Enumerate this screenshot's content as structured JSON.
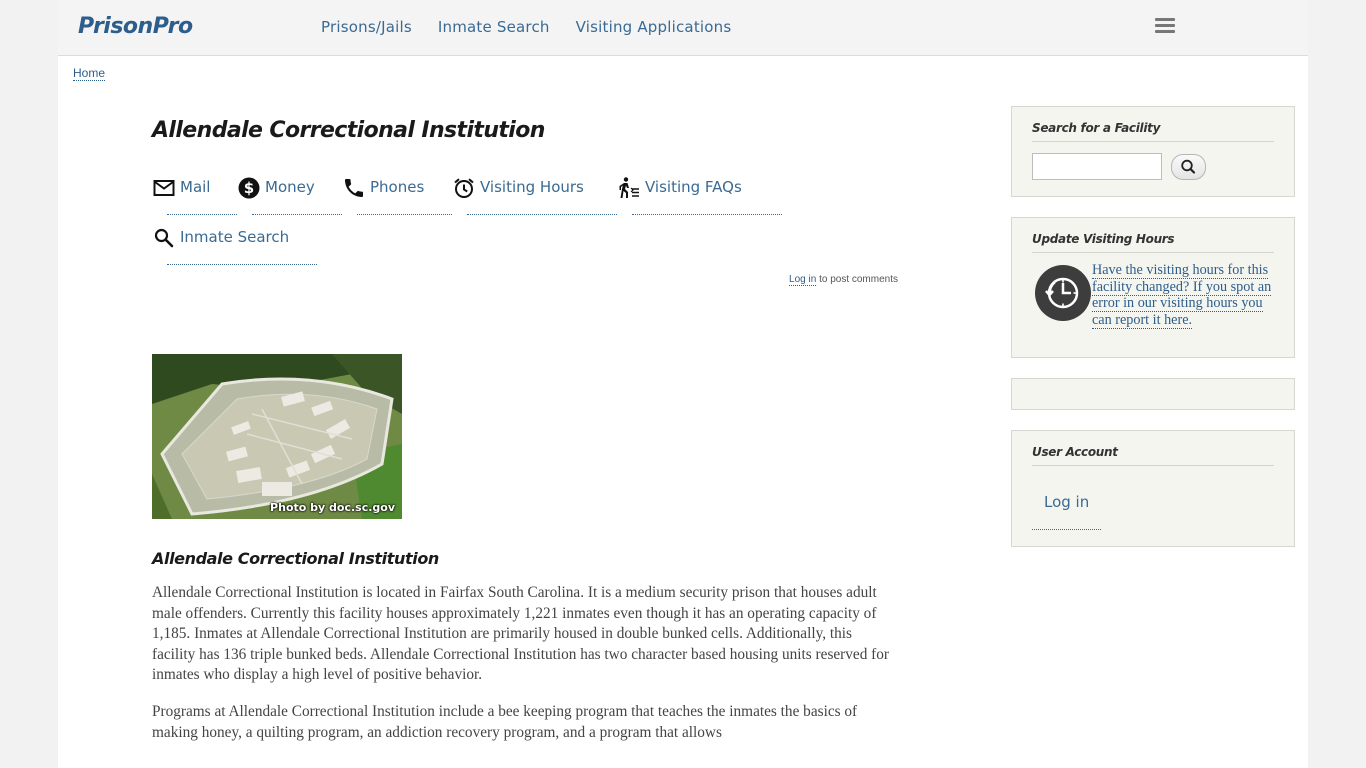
{
  "site": {
    "logo": "PrisonPro"
  },
  "nav": {
    "items": [
      {
        "label": "Prisons/Jails"
      },
      {
        "label": "Inmate Search"
      },
      {
        "label": "Visiting Applications"
      }
    ]
  },
  "breadcrumb": {
    "home": "Home"
  },
  "page": {
    "title": "Allendale Correctional Institution",
    "tabs": [
      {
        "label": "Mail",
        "icon": "mail-icon"
      },
      {
        "label": "Money",
        "icon": "dollar-icon"
      },
      {
        "label": "Phones",
        "icon": "phone-icon"
      },
      {
        "label": "Visiting Hours",
        "icon": "alarm-clock-icon"
      },
      {
        "label": "Visiting FAQs",
        "icon": "person-walking-icon"
      },
      {
        "label": "Inmate Search",
        "icon": "search-icon"
      }
    ],
    "login_link": "Log in",
    "login_suffix": " to post comments",
    "photo_credit": "Photo by doc.sc.gov",
    "subtitle": "Allendale Correctional Institution",
    "paragraphs": [
      "Allendale Correctional Institution is located in Fairfax South Carolina.  It is a medium security prison that houses adult male offenders.  Currently this facility houses approximately 1,221 inmates even though it has an operating capacity of 1,185.  Inmates at Allendale Correctional Institution are primarily housed in double bunked cells.  Additionally, this facility has 136 triple bunked beds.  Allendale Correctional Institution has two character based housing units reserved for inmates who display a high level of positive behavior.",
      "Programs at Allendale Correctional Institution include a bee keeping program that teaches the inmates the basics of making honey, a quilting program, an addiction recovery program, and a program that allows"
    ]
  },
  "sidebar": {
    "search": {
      "title": "Search for a Facility",
      "value": ""
    },
    "update": {
      "title": "Update Visiting Hours",
      "link": "Have the visiting hours for this facility changed?  If you spot an error in our visiting hours you can report it here."
    },
    "account": {
      "title": "User Account",
      "login": "Log in"
    }
  },
  "colors": {
    "link": "#3a6a93",
    "logo": "#2d5d8a",
    "block_bg": "#f5f5f0"
  }
}
